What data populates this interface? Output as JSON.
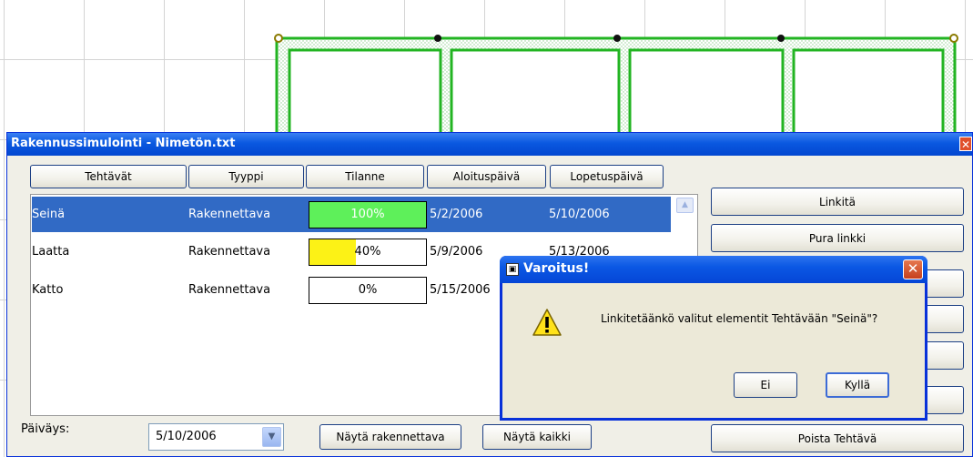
{
  "main_window": {
    "title": "Rakennussimulointi - Nimetön.txt",
    "close_glyph": "✕"
  },
  "columns": [
    "Tehtävät",
    "Tyyppi",
    "Tilanne",
    "Aloituspäivä",
    "Lopetuspäivä"
  ],
  "tasks": [
    {
      "name": "Seinä",
      "type": "Rakennettava",
      "progress": 100,
      "progress_label": "100%",
      "progress_color": "#5ef05a",
      "start": "5/2/2006",
      "end": "5/10/2006",
      "selected": true
    },
    {
      "name": "Laatta",
      "type": "Rakennettava",
      "progress": 40,
      "progress_label": "40%",
      "progress_color": "#fcf216",
      "start": "5/9/2006",
      "end": "5/13/2006",
      "selected": false
    },
    {
      "name": "Katto",
      "type": "Rakennettava",
      "progress": 0,
      "progress_label": "0%",
      "progress_color": "#ffffff",
      "start": "5/15/2006",
      "end": "",
      "selected": false
    }
  ],
  "side_buttons": {
    "link": "Linkitä",
    "unlink": "Pura linkki",
    "delete_task": "Poista Tehtävä"
  },
  "bottom": {
    "date_label": "Päiväys:",
    "date_value": "5/10/2006",
    "show_buildable": "Näytä rakennettava",
    "show_all": "Näytä kaikki"
  },
  "dialog": {
    "title": "Varoitus!",
    "message": "Linkitetäänkö valitut elementit Tehtävään \"Seinä\"?",
    "no_button": "Ei",
    "yes_button": "Kyllä",
    "icon": "warning-icon"
  },
  "colors": {
    "selection": "#316ac5",
    "wall_green": "#22b422",
    "titlebar_blue": "#0a58e0"
  }
}
